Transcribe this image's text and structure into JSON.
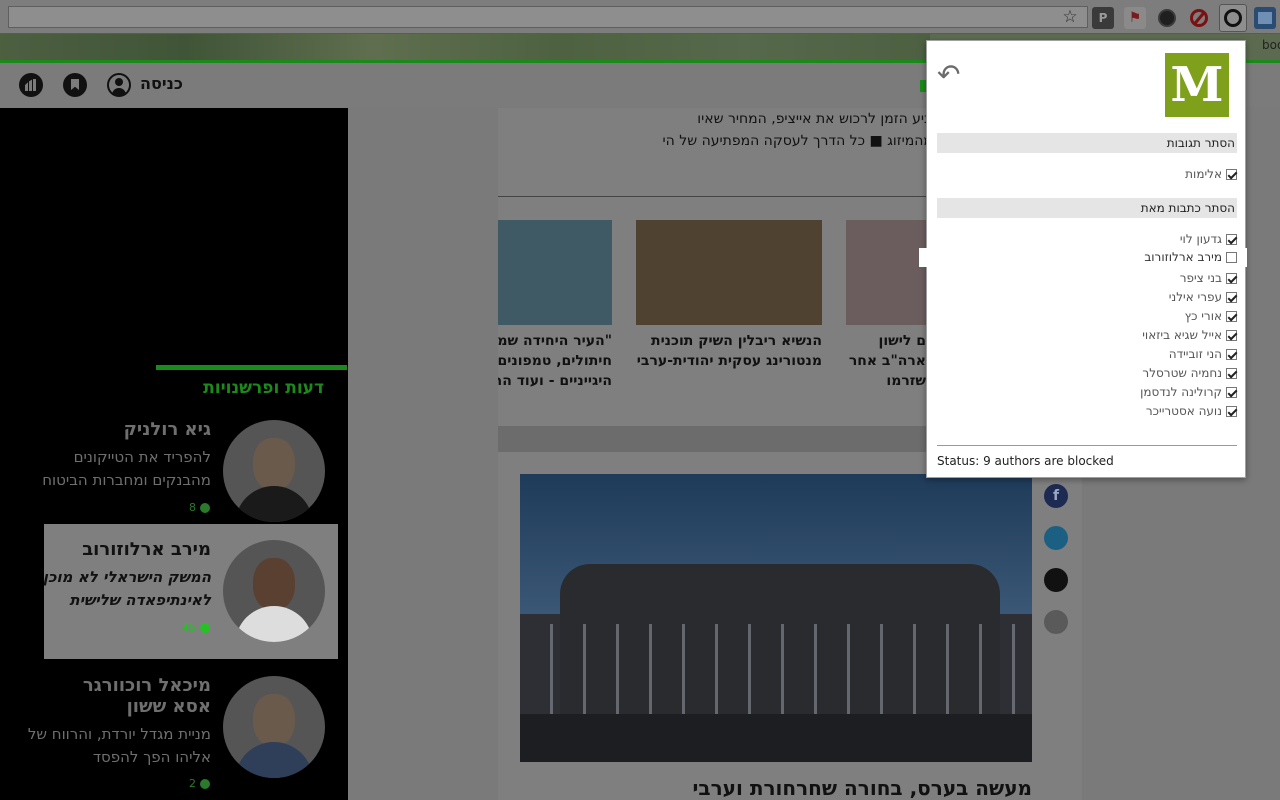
{
  "browser": {
    "bookmark_fragment": "bookm",
    "star_glyph": "☆"
  },
  "site_bar": {
    "login_label": "כניסה"
  },
  "ticker": {
    "line1": "ות מן, מנכ\"ל מאגנוס, שהגיע הזמן לרכוש את אייציפ, המחיר שאיו",
    "line2": "מה בעצם כולם מרוויחים מהמיזוג ■ כל הדרך לעסקה המפתיעה של הי"
  },
  "thumbs": [
    {
      "caption1": "ם לישון",
      "caption2": "ארה\"ב אחר",
      "caption3": "שזרמו"
    },
    {
      "caption1": "הנשיא ריבלין השיק תוכנית",
      "caption2": "מנטורינג עסקית יהודית-ערבית",
      "caption3": ""
    },
    {
      "caption1": "\"העיר היחידה שמז",
      "caption2": "חיתולים, טמפונים,",
      "caption3": "היגייניים - ועוד הרג"
    }
  ],
  "headline": "מעשה בערס, בחורה שחרחורת וערבי שפוטר",
  "sidebar": {
    "section_title": "דעות ופרשנויות",
    "cards": [
      {
        "name": "גיא רולניק",
        "desc1": "להפריד את הטייקונים",
        "desc2": "מהבנקים ומחברות הביטוח",
        "comments": "8"
      },
      {
        "name": "מירב ארלוזורוב",
        "desc1": "המשק הישראלי לא מוכן",
        "desc2": "לאינתיפאדה שלישית",
        "comments": "45"
      },
      {
        "name": "מיכאל רוכוורגר",
        "name2": "אסא ששון",
        "desc1": "מניית מגדל יורדת, והרווח של",
        "desc2": "אליהו הפך להפסד",
        "comments": "2"
      }
    ]
  },
  "popup": {
    "logo_letter": "M",
    "back_glyph": "↶",
    "section_reactions": "הסתר תגובות",
    "violence_label": "אלימות",
    "section_authors": "הסתר כתבות מאת",
    "authors": [
      {
        "name": "גדעון לוי",
        "checked": true
      },
      {
        "name": "מירב ארלוזורוב",
        "checked": false
      },
      {
        "name": "בני ציפר",
        "checked": true
      },
      {
        "name": "עפרי אילני",
        "checked": true
      },
      {
        "name": "אורי כץ",
        "checked": true
      },
      {
        "name": "אייל שגיא ביזאוי",
        "checked": true
      },
      {
        "name": "הני זוביידה",
        "checked": true
      },
      {
        "name": "נחמיה שטרסלר",
        "checked": true
      },
      {
        "name": "קרולינה לנדסמן",
        "checked": true
      },
      {
        "name": "נועה אסטרייכר",
        "checked": true
      }
    ],
    "status": "Status: 9 authors are blocked"
  },
  "share": {
    "facebook_glyph": "f"
  },
  "colors": {
    "accent_green": "#1a8a1a",
    "logo_green": "#7ea01a",
    "active_comment_green": "#24c224"
  }
}
